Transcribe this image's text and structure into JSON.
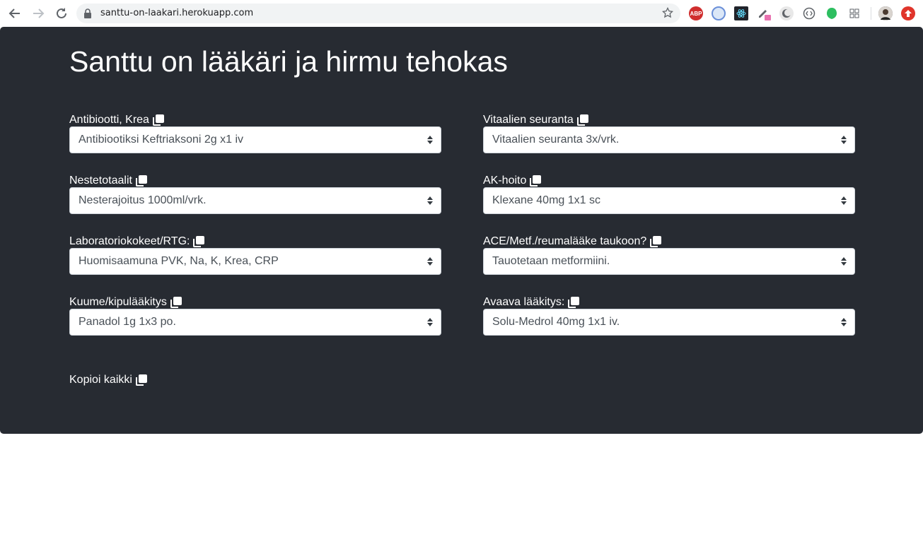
{
  "browser": {
    "url": "santtu-on-laakari.herokuapp.com"
  },
  "page": {
    "title": "Santtu on lääkäri ja hirmu tehokas",
    "copy_all_label": "Kopioi kaikki"
  },
  "fields": [
    {
      "label": "Antibiootti, Krea",
      "value": "Antibiootiksi Keftriaksoni 2g x1 iv"
    },
    {
      "label": "Vitaalien seuranta",
      "value": "Vitaalien seuranta 3x/vrk."
    },
    {
      "label": "Nestetotaalit",
      "value": "Nesterajoitus 1000ml/vrk."
    },
    {
      "label": "AK-hoito",
      "value": "Klexane 40mg 1x1 sc"
    },
    {
      "label": "Laboratoriokokeet/RTG:",
      "value": "Huomisaamuna PVK, Na, K, Krea, CRP"
    },
    {
      "label": "ACE/Metf./reumalääke taukoon?",
      "value": "Tauotetaan metformiini."
    },
    {
      "label": "Kuume/kipulääkitys",
      "value": "Panadol 1g 1x3 po."
    },
    {
      "label": "Avaava lääkitys:",
      "value": "Solu-Medrol 40mg 1x1 iv."
    }
  ],
  "extensions": {
    "abp_label": "ABP"
  },
  "colors": {
    "page_background": "#272b32",
    "text": "#ffffff",
    "select_text": "#495057"
  }
}
